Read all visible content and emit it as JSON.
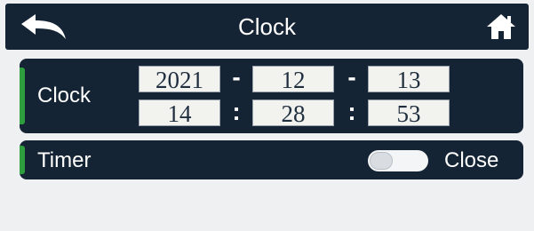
{
  "header": {
    "title": "Clock",
    "back_icon": "back-arrow-icon",
    "home_icon": "home-icon"
  },
  "clock_panel": {
    "label": "Clock",
    "date": {
      "year": "2021",
      "month": "12",
      "day": "13",
      "separator": "-"
    },
    "time": {
      "hour": "14",
      "minute": "28",
      "second": "53",
      "separator": ":"
    }
  },
  "timer_panel": {
    "label": "Timer",
    "toggle_state": "Close"
  },
  "colors": {
    "panel_bg": "#152434",
    "accent_green": "#2e9e3e",
    "screen_bg": "#eef0f2"
  }
}
